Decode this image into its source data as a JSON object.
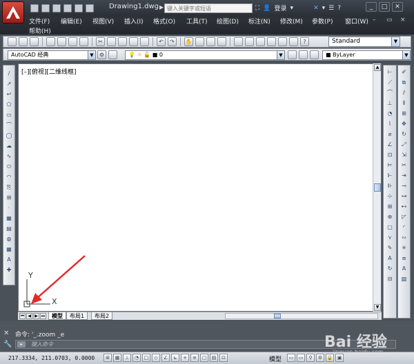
{
  "titlebar": {
    "doc_title": "Drawing1.dwg",
    "search_placeholder": "键入关键字或短语",
    "login": "登录"
  },
  "menu": [
    "文件(F)",
    "编辑(E)",
    "视图(V)",
    "插入(I)",
    "格式(O)",
    "工具(T)",
    "绘图(D)",
    "标注(N)",
    "修改(M)",
    "参数(P)",
    "窗口(W)",
    "帮助(H)"
  ],
  "toolbar": {
    "text_style": "Standard",
    "workspace": "AutoCAD 经典",
    "layer": "0",
    "color": "ByLayer"
  },
  "drawing": {
    "view_label": "[–][俯视][二维线框]",
    "ucs_x": "X",
    "ucs_y": "Y"
  },
  "tabs": [
    "模型",
    "布局1",
    "布局2"
  ],
  "command": {
    "history": "命令: '_.zoom _e",
    "placeholder": "键入命令"
  },
  "status": {
    "coords": "217.3334, 211.0703, 0.0000",
    "model": "模型"
  },
  "watermark": {
    "text": "Bai 经验",
    "sub": "jingyan.baidu.com"
  },
  "colors": {
    "arrow": "#e22b2b",
    "chrome_dark": "#2b3037"
  }
}
